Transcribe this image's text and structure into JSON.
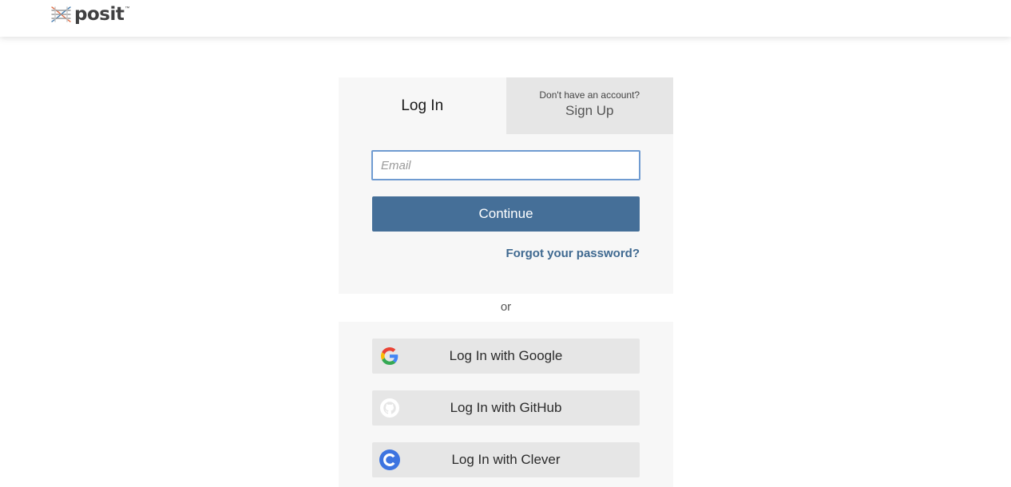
{
  "brand": {
    "name": "posit",
    "trademark": "™"
  },
  "tabs": {
    "login_label": "Log In",
    "signup_hint": "Don't have an account?",
    "signup_label": "Sign Up"
  },
  "form": {
    "email_placeholder": "Email",
    "email_value": "",
    "continue_label": "Continue",
    "forgot_label": "Forgot your password?"
  },
  "divider": {
    "or_label": "or"
  },
  "social": {
    "google_label": "Log In with Google",
    "github_label": "Log In with GitHub",
    "clever_label": "Log In with Clever"
  },
  "icons": {
    "logo": "posit-logo-icon",
    "google": "google-icon",
    "github": "github-icon",
    "clever": "clever-icon"
  },
  "colors": {
    "primary": "#456f98",
    "link": "#3f6990",
    "focus_border": "#6f9bd1",
    "panel": "#f7f7f7",
    "button_secondary": "#e6e6e6"
  }
}
